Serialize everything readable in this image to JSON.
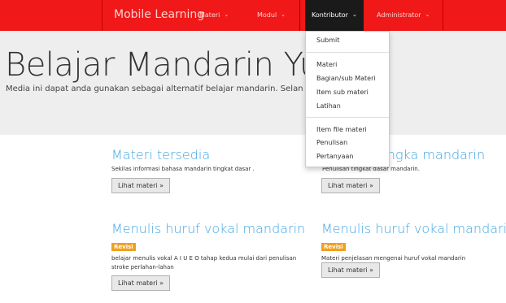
{
  "navbar": {
    "brand": "Mobile Learning",
    "items": [
      {
        "label": "Materi",
        "caret": "⌄"
      },
      {
        "label": "Modul",
        "caret": "⌄"
      },
      {
        "label": "Kontributor",
        "caret": "⌄"
      },
      {
        "label": "Administrator",
        "caret": "⌄"
      }
    ]
  },
  "jumbotron": {
    "title": "Belajar Mandarin Yuk!",
    "subtitle": "Media ini dapat anda gunakan sebagai alternatif belajar mandarin. Selan"
  },
  "cards": [
    {
      "title": "Materi tersedia",
      "text": "Sekilas informasi bahasa mandarin tingkat dasar .",
      "button": "Lihat materi »"
    },
    {
      "title": "angka mandarin",
      "text": "Penulisan tingkat dasar mandarin.",
      "button": "Lihat materi »"
    },
    {
      "title": "Menulis huruf vokal mandarin",
      "badge": "Revisi",
      "text": "belajar menulis vokal A I U E O tahap kedua mulai dari penulisan stroke perlahan-lahan",
      "button": "Lihat materi »"
    },
    {
      "title": "Menulis huruf vokal mandarin",
      "badge": "Revisi",
      "text": "Materi penjelasan mengenai huruf vokal mandarin",
      "button": "Lihat materi »"
    }
  ],
  "dropdown": {
    "items": [
      "Submit",
      "Materi",
      "Bagian/sub Materi",
      "Item sub materi",
      "Latihan",
      "Item file materi",
      "Penulisan",
      "Pertanyaan"
    ]
  }
}
